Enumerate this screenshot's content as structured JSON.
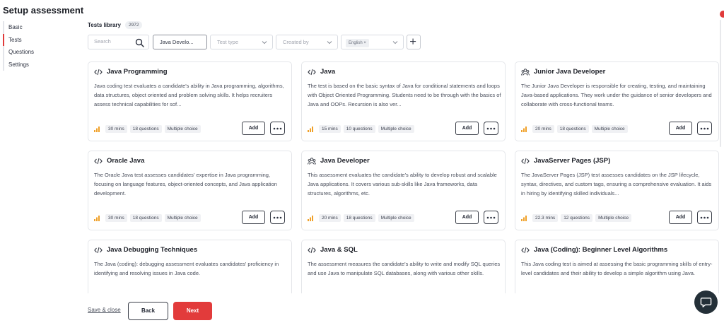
{
  "page": {
    "title": "Setup assessment"
  },
  "sidebar": {
    "items": [
      {
        "label": "Basic",
        "active": false
      },
      {
        "label": "Tests",
        "active": true
      },
      {
        "label": "Questions",
        "active": false
      },
      {
        "label": "Settings",
        "active": false
      }
    ]
  },
  "library": {
    "title": "Tests library",
    "count": "2972"
  },
  "filters": {
    "search_placeholder": "Search",
    "job_role": "Java Develo...",
    "test_type_placeholder": "Test type",
    "created_by_placeholder": "Created by",
    "language_chip": "English ×"
  },
  "cards": [
    {
      "title": "Java Programming",
      "icon": "code-icon",
      "description": "Java coding test evaluates a candidate's ability in Java programming, algorithms, data structures, object oriented and problem solving skills. It helps recruiters assess technical capabilities for sof...",
      "duration": "30 mins",
      "questions": "18 questions",
      "type": "Multiple choice",
      "add_label": "Add"
    },
    {
      "title": "Java",
      "icon": "code-icon",
      "description": "The test is based on the basic syntax of Java for conditional statements and loops with Object Oriented Programming. Students need to be through with the basics of Java and OOPs. Recursion is also ver...",
      "duration": "15 mins",
      "questions": "10 questions",
      "type": "Multiple choice",
      "add_label": "Add"
    },
    {
      "title": "Junior Java Developer",
      "icon": "people-icon",
      "description": "The Junior Java Developer is responsible for creating, testing, and maintaining Java-based applications. They work under the guidance of senior developers and collaborate with cross-functional teams.",
      "duration": "20 mins",
      "questions": "18 questions",
      "type": "Multiple choice",
      "add_label": "Add"
    },
    {
      "title": "Oracle Java",
      "icon": "code-icon",
      "description": "The Oracle Java test assesses candidates' expertise in Java programming, focusing on language features, object-oriented concepts, and Java application development.",
      "duration": "30 mins",
      "questions": "18 questions",
      "type": "Multiple choice",
      "add_label": "Add"
    },
    {
      "title": "Java Developer",
      "icon": "people-icon",
      "description": "This assessment evaluates the candidate's ability to develop robust and scalable Java applications. It covers various sub-skills like Java frameworks, data structures, algorithms, etc.",
      "duration": "20 mins",
      "questions": "18 questions",
      "type": "Multiple choice",
      "add_label": "Add"
    },
    {
      "title": "JavaServer Pages (JSP)",
      "icon": "code-icon",
      "description": "The JavaServer Pages (JSP) test assesses candidates on the JSP lifecycle, syntax, directives, and custom tags, ensuring a comprehensive evaluation. It aids in hiring by identifying skilled individuals...",
      "duration": "22.3 mins",
      "questions": "12 questions",
      "type": "Multiple choice",
      "add_label": "Add"
    },
    {
      "title": "Java Debugging Techniques",
      "icon": "code-icon",
      "description": "The Java (coding): debugging assessment evaluates candidates' proficiency in identifying and resolving issues in Java code."
    },
    {
      "title": "Java & SQL",
      "icon": "code-icon",
      "description": "The assessment measures the candidate's ability to write and modify SQL queries and use Java to manipulate SQL databases, along with various other skills."
    },
    {
      "title": "Java (Coding): Beginner Level Algorithms",
      "icon": "code-icon",
      "description": "This Java coding test is aimed at assessing the basic programming skills of entry-level candidates and their ability to develop a simple algorithm using Java."
    }
  ],
  "footer": {
    "save_close": "Save & close",
    "back": "Back",
    "next": "Next"
  },
  "colors": {
    "accent": "#e23b3b",
    "level_bar": "#f0a12a",
    "chat_bubble": "#243038"
  }
}
